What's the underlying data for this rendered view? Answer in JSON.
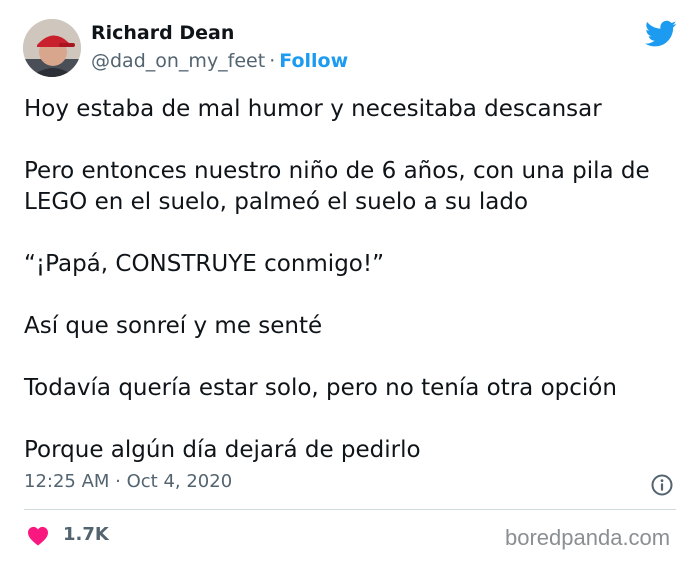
{
  "author": {
    "name": "Richard Dean",
    "handle": "@dad_on_my_feet",
    "separator": "·",
    "follow_label": "Follow"
  },
  "tweet": {
    "paragraphs": [
      "Hoy estaba de mal humor y necesitaba descansar",
      "Pero entonces nuestro niño de 6 años, con una pila de LEGO en el suelo, palmeó el suelo a su lado",
      "“¡Papá, CONSTRUYE conmigo!”",
      "Así que sonreí y me senté",
      "Todavía quería estar solo, pero no tenía otra opción",
      "Porque algún día dejará de pedirlo"
    ],
    "timestamp": "12:25 AM · Oct 4, 2020"
  },
  "engagement": {
    "likes": "1.7K"
  },
  "watermark": "boredpanda.com",
  "icons": {
    "brand": "twitter-bird-icon",
    "info": "info-icon",
    "like": "heart-icon"
  },
  "colors": {
    "accent": "#1d9bf0",
    "like": "#f91880",
    "muted": "#536471",
    "text": "#0f1419"
  }
}
